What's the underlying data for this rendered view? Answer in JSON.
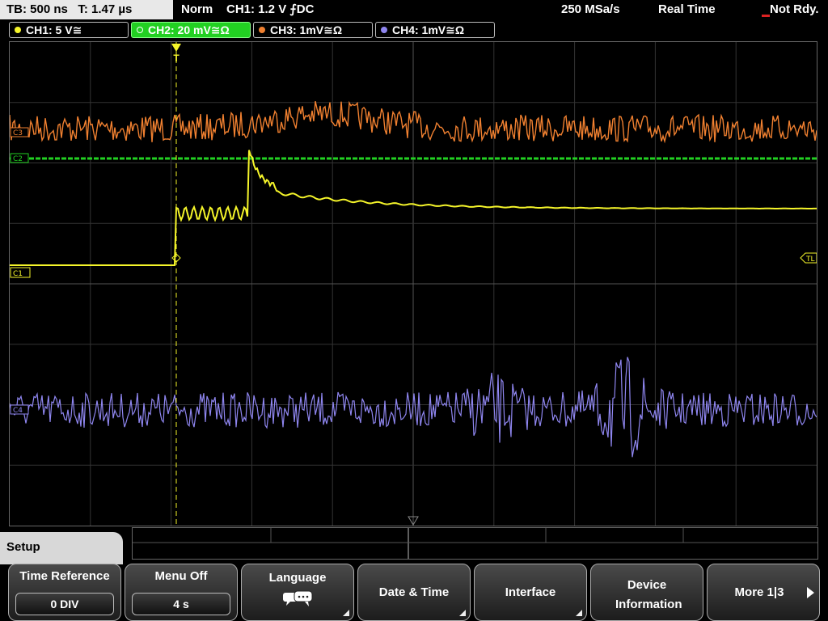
{
  "status_bar": {
    "timebase": "TB: 500 ns",
    "trigger_time": "T: 1.47 µs",
    "mode": "Norm",
    "trigger_info": "CH1: 1.2 V ⨍DC",
    "sample_rate": "250 MSa/s",
    "acq_mode": "Real Time",
    "state": "Not Rdy."
  },
  "channels": [
    {
      "label": "CH1: 5 V≅",
      "color": "#f5f52a"
    },
    {
      "label": "CH2: 20 mV≅Ω",
      "color": "#22d022",
      "active": true
    },
    {
      "label": "CH3: 1mV≅Ω",
      "color": "#f08030"
    },
    {
      "label": "CH4: 1mV≅Ω",
      "color": "#8f86f0"
    }
  ],
  "markers": {
    "c1": "C1",
    "c2": "C2",
    "c3": "C3",
    "c4": "C4",
    "tl": "TL",
    "trigger": "T"
  },
  "menu": {
    "title": "Setup",
    "softkeys": [
      {
        "label": "Time Reference",
        "value": "0 DIV"
      },
      {
        "label": "Menu Off",
        "value": "4 s"
      },
      {
        "label": "Language",
        "icon": "speech-bubbles-icon"
      },
      {
        "label": "Date & Time"
      },
      {
        "label": "Interface"
      },
      {
        "label": "Device Information"
      },
      {
        "label": "More 1|3"
      }
    ]
  }
}
